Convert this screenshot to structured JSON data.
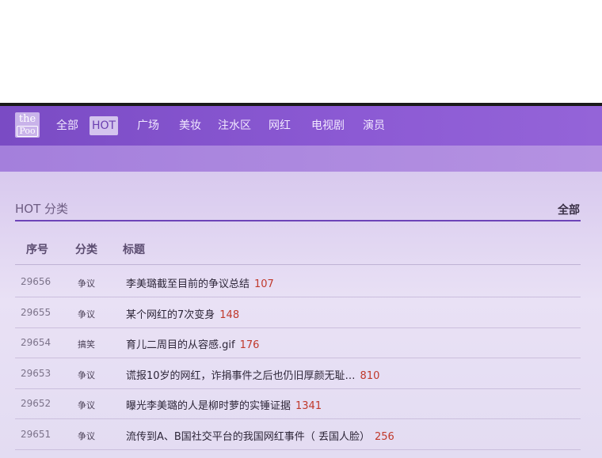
{
  "nav": {
    "logo_top": "the",
    "logo_bottom": "Poo",
    "items": [
      "全部",
      "HOT",
      "广场",
      "美妆",
      "注水区",
      "网红",
      "电视剧",
      "演员"
    ],
    "active": "HOT"
  },
  "section": {
    "title": "HOT 分类",
    "all_link": "全部"
  },
  "table": {
    "headers": [
      "序号",
      "分类",
      "标题"
    ],
    "rows": [
      {
        "num": "29656",
        "cat": "争议",
        "title": "李美璐截至目前的争议总结",
        "count": "107"
      },
      {
        "num": "29655",
        "cat": "争议",
        "title": "某个网红的7次变身",
        "count": "148"
      },
      {
        "num": "29654",
        "cat": "搞笑",
        "title": "育儿二周目的从容感.gif",
        "count": "176"
      },
      {
        "num": "29653",
        "cat": "争议",
        "title": "谎报10岁的网红，诈捐事件之后也仍旧厚颜无耻…",
        "count": "810"
      },
      {
        "num": "29652",
        "cat": "争议",
        "title": "曝光李美璐的人是柳时萝的实锤证据",
        "count": "1341"
      },
      {
        "num": "29651",
        "cat": "争议",
        "title": "流传到A、B国社交平台的我国网红事件（ 丢国人脸）",
        "count": "256"
      }
    ]
  },
  "colors": {
    "nav_bg": "#8358cc",
    "accent": "#6d44b8",
    "count": "#c0392b"
  }
}
